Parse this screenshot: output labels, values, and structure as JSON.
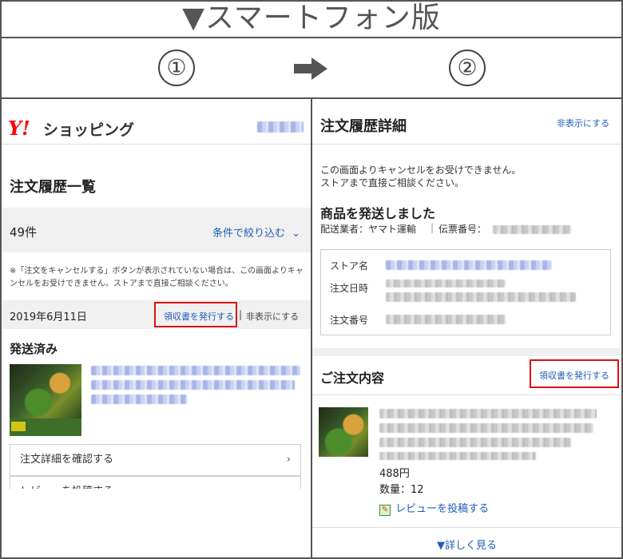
{
  "header": {
    "title": "▼スマートフォン版",
    "step1": "①",
    "step2": "②"
  },
  "left": {
    "logo_y": "Y!",
    "logo_text": "ショッピング",
    "page_title": "注文履歴一覧",
    "count": "49件",
    "filter_label": "条件で絞り込む",
    "note": "※「注文をキャンセルする」ボタンが表示されていない場合は、この画面よりキャンセルをお受けできません。ストアまで直接ご相談ください。",
    "order_date": "2019年6月11日",
    "receipt_link": "領収書を発行する",
    "hide_link": "非表示にする",
    "status": "発送済み",
    "detail_button": "注文詳細を確認する",
    "review_button": "レビューを投稿する"
  },
  "right": {
    "page_title": "注文履歴詳細",
    "hide_link": "非表示にする",
    "cancel_note_line1": "この画面よりキャンセルをお受けできません。",
    "cancel_note_line2": "ストアまで直接ご相談ください。",
    "shipped_heading": "商品を発送しました",
    "carrier": "配送業者：ヤマト運輸",
    "tracking_label": "伝票番号：",
    "store_label": "ストア名",
    "date_label": "注文日時",
    "number_label": "注文番号",
    "order_heading": "ご注文内容",
    "receipt_button": "領収書を発行する",
    "price": "488円",
    "quantity": "数量：12",
    "review_link": "レビューを投稿する",
    "more_link": "▼詳しく見る"
  },
  "colors": {
    "link": "#1f5db8",
    "highlight": "#dd1111",
    "logo": "#ff0000"
  }
}
